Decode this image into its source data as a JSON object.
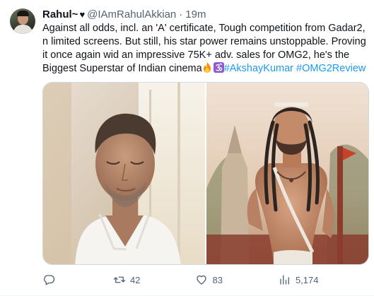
{
  "author": {
    "name": "Rahul~",
    "handle": "@IAmRahulAkkian",
    "separator": "·",
    "time": "19m"
  },
  "tweet": {
    "body": "Against all odds, incl. an 'A' certificate, Tough competition from Gadar2, n limited screens. But still, his star power remains unstoppable. Proving it once again wid an impressive 75K+ adv. sales for OMG2, he's the Biggest Superstar of Indian cinema",
    "hashtags": [
      "#AkshayKumar",
      "#OMG2Review"
    ]
  },
  "actions": {
    "reply_count": "",
    "retweet_count": "42",
    "like_count": "83",
    "view_count": "5,174"
  },
  "icons": {
    "verified": "heart-icon",
    "reply": "reply-icon",
    "retweet": "retweet-icon",
    "like": "like-icon",
    "views": "views-icon",
    "share": "share-icon"
  },
  "colors": {
    "link": "#1d9bf0",
    "secondary_text": "#536471"
  }
}
